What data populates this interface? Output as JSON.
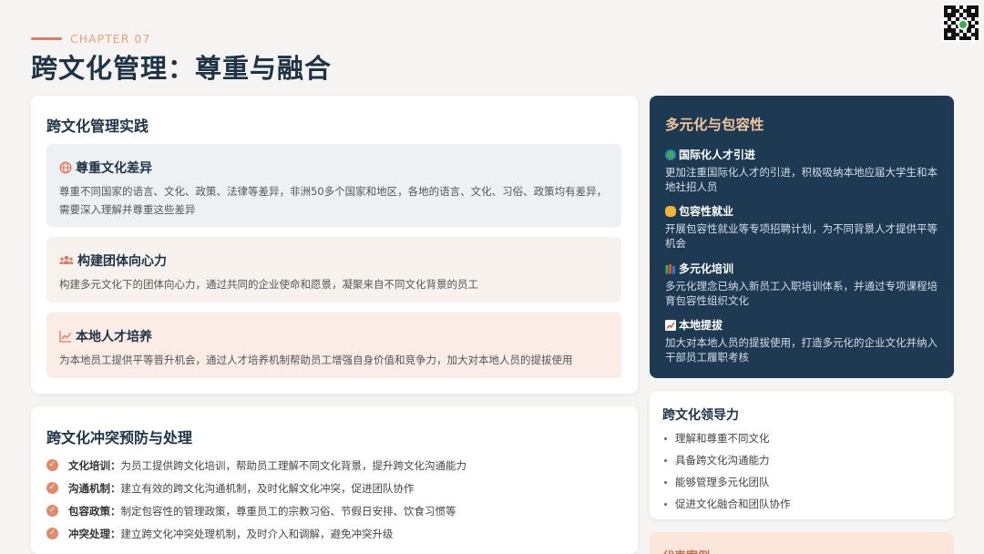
{
  "header": {
    "chapter": "CHAPTER 07",
    "title": "跨文化管理：尊重与融合"
  },
  "colors": {
    "accent": "#e07a5f",
    "navy": "#1e3a52",
    "title": "#1f3347"
  },
  "practice": {
    "title": "跨文化管理实践",
    "items": [
      {
        "icon": "globe-icon",
        "title": "尊重文化差异",
        "text": "尊重不同国家的语言、文化、政策、法律等差异，非洲50多个国家和地区，各地的语言、文化、习俗、政策均有差异，需要深入理解并尊重这些差异"
      },
      {
        "icon": "people-group-icon",
        "title": "构建团体向心力",
        "text": "构建多元文化下的团体向心力，通过共同的企业使命和愿景，凝聚来自不同文化背景的员工"
      },
      {
        "icon": "chart-line-icon",
        "title": "本地人才培养",
        "text": "为本地员工提供平等晋升机会，通过人才培养机制帮助员工增强自身价值和竞争力，加大对本地人员的提拔使用"
      }
    ]
  },
  "conflict": {
    "title": "跨文化冲突预防与处理",
    "items": [
      {
        "key": "文化培训：",
        "text": "为员工提供跨文化培训，帮助员工理解不同文化背景，提升跨文化沟通能力"
      },
      {
        "key": "沟通机制：",
        "text": "建立有效的跨文化沟通机制，及时化解文化冲突，促进团队协作"
      },
      {
        "key": "包容政策：",
        "text": "制定包容性的管理政策，尊重员工的宗教习俗、节假日安排、饮食习惯等"
      },
      {
        "key": "冲突处理：",
        "text": "建立跨文化冲突处理机制，及时介入和调解，避免冲突升级"
      }
    ]
  },
  "diversity": {
    "title": "多元化与包容性",
    "items": [
      {
        "icon": "globe-emoji-icon",
        "title": "国际化人才引进",
        "text": "更加注重国际化人才的引进，积极吸纳本地应届大学生和本地社招人员"
      },
      {
        "icon": "handshake-icon",
        "title": "包容性就业",
        "text": "开展包容性就业等专项招聘计划，为不同背景人才提供平等机会"
      },
      {
        "icon": "books-icon",
        "title": "多元化培训",
        "text": "多元化理念已纳入新员工入职培训体系，并通过专项课程培育包容性组织文化"
      },
      {
        "icon": "chart-up-icon",
        "title": "本地提拔",
        "text": "加大对本地人员的提拔使用，打造多元化的企业文化并纳入干部员工履职考核"
      }
    ]
  },
  "leadership": {
    "title": "跨文化领导力",
    "items": [
      "理解和尊重不同文化",
      "具备跨文化沟通能力",
      "能够管理多元化团队",
      "促进文化融合和团队协作"
    ]
  },
  "peek": {
    "title": "代表案例"
  }
}
